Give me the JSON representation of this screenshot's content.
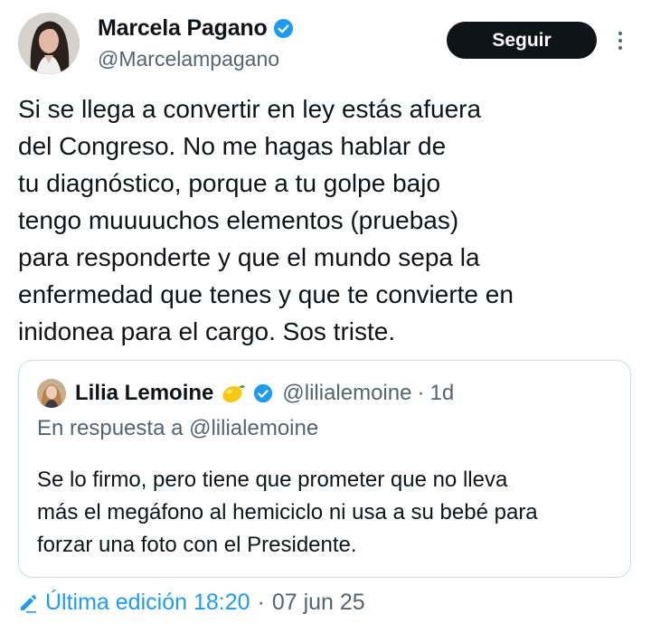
{
  "author": {
    "name": "Marcela Pagano",
    "handle": "@Marcelampagano",
    "verified_icon": "verified-badge-icon",
    "follow_label": "Seguir"
  },
  "tweet": {
    "lines": [
      "Si se llega a convertir en ley estás afuera",
      "del Congreso. No me hagas hablar de",
      "tu diagnóstico, porque a tu golpe bajo",
      "tengo muuuuchos elementos (pruebas)",
      "para responderte y que el mundo sepa la",
      "enfermedad que tenes y que te convierte en",
      "inidonea para el cargo. Sos triste."
    ]
  },
  "quoted": {
    "name": "Lilia Lemoine",
    "emoji": "lemon-icon",
    "handle": "@lilialemoine",
    "separator": "·",
    "time": "1d",
    "reply_to": "En respuesta a @lilialemoine",
    "lines": [
      "Se lo firmo, pero tiene que prometer que no lleva",
      "más el megáfono al hemiciclo ni usa a su bebé para",
      "forzar una foto con el Presidente."
    ]
  },
  "footer": {
    "edit_label": "Última edición 18:20",
    "separator": "·",
    "date": "07 jun 25"
  },
  "colors": {
    "accent": "#1d9bf0",
    "secondary_text": "#536471",
    "text": "#0f1419",
    "border": "#cfd9de",
    "button": "#0f1419"
  }
}
